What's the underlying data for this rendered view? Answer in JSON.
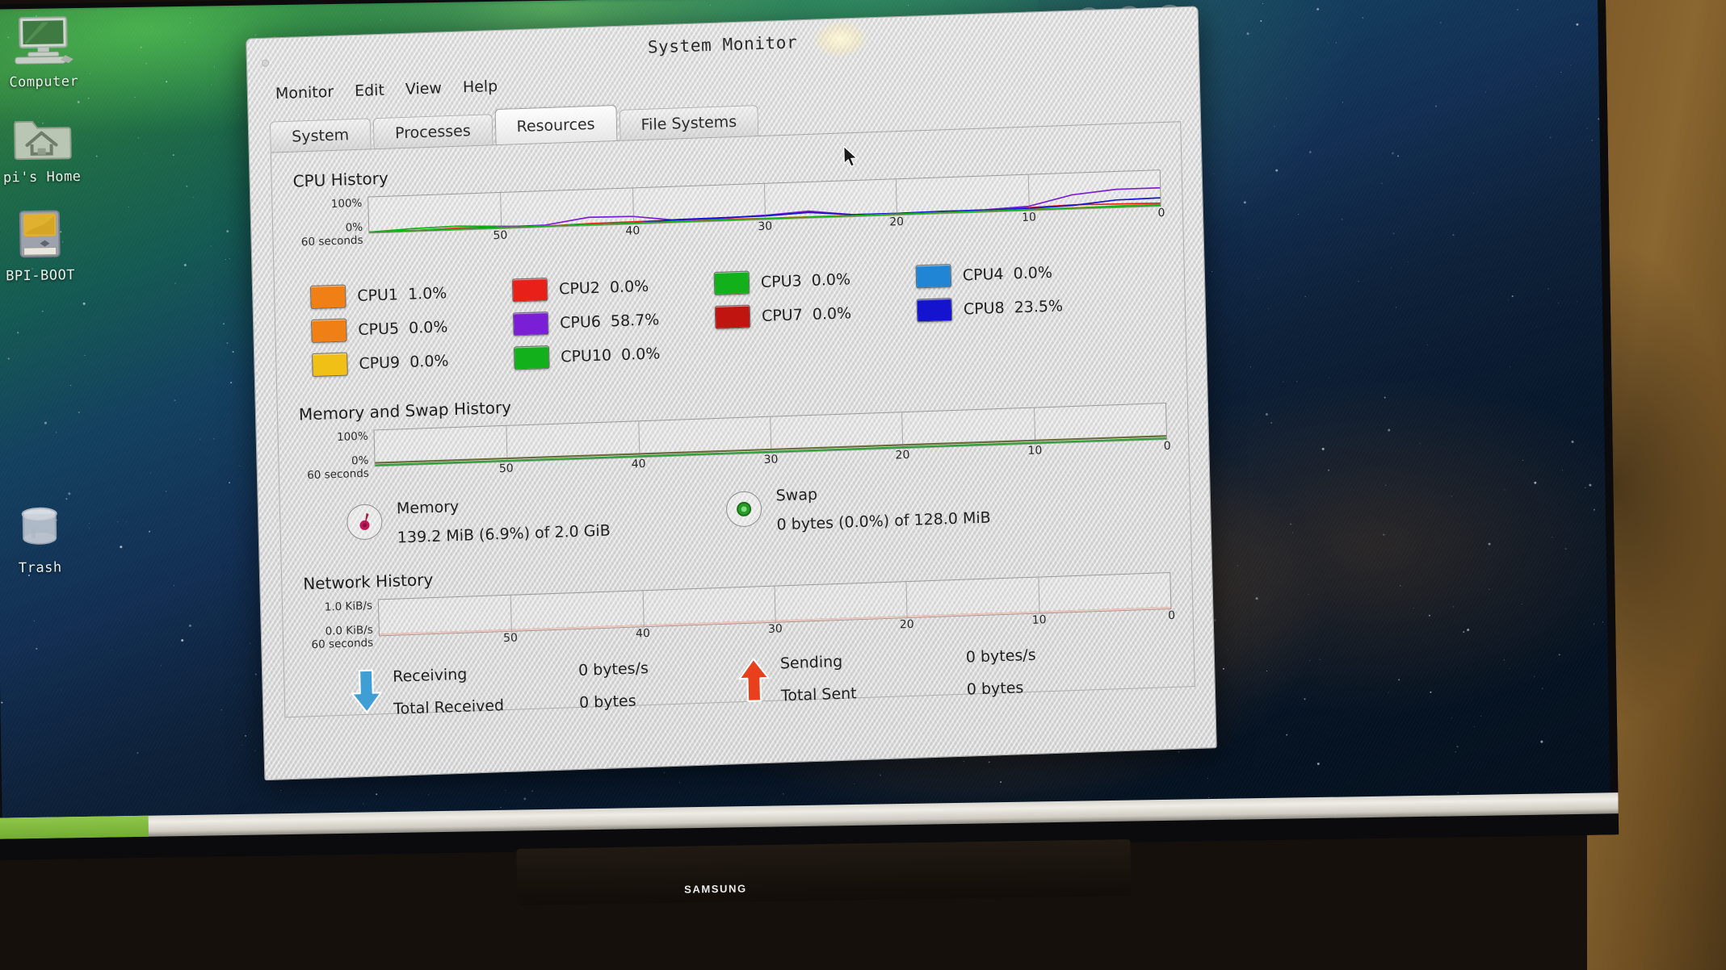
{
  "desktop": {
    "icons": [
      {
        "name": "Computer",
        "icon": "computer-icon"
      },
      {
        "name": "pi's Home",
        "icon": "home-folder-icon"
      },
      {
        "name": "BPI-BOOT",
        "icon": "drive-icon"
      },
      {
        "name": "Trash",
        "icon": "trash-icon"
      }
    ]
  },
  "tv": {
    "brand": "SAMSUNG"
  },
  "window": {
    "title": "System Monitor",
    "controls": {
      "minimize": "⌄",
      "maximize": "⌃",
      "close": "✕"
    },
    "menu": [
      "Monitor",
      "Edit",
      "View",
      "Help"
    ],
    "tabs": [
      {
        "label": "System",
        "active": false
      },
      {
        "label": "Processes",
        "active": false
      },
      {
        "label": "Resources",
        "active": true
      },
      {
        "label": "File Systems",
        "active": false
      }
    ]
  },
  "sections": {
    "cpu": {
      "title": "CPU History"
    },
    "memory": {
      "title": "Memory and Swap History"
    },
    "network": {
      "title": "Network History"
    }
  },
  "cpu_legend": [
    {
      "label": "CPU1",
      "value": "1.0%",
      "color": "#f07f16"
    },
    {
      "label": "CPU2",
      "value": "0.0%",
      "color": "#e8201a"
    },
    {
      "label": "CPU3",
      "value": "0.0%",
      "color": "#12b01a"
    },
    {
      "label": "CPU4",
      "value": "0.0%",
      "color": "#1f85d4"
    },
    {
      "label": "CPU5",
      "value": "0.0%",
      "color": "#f07f16"
    },
    {
      "label": "CPU6",
      "value": "58.7%",
      "color": "#7b1fd6"
    },
    {
      "label": "CPU7",
      "value": "0.0%",
      "color": "#bf1410"
    },
    {
      "label": "CPU8",
      "value": "23.5%",
      "color": "#1414cf"
    },
    {
      "label": "CPU9",
      "value": "0.0%",
      "color": "#f0c017"
    },
    {
      "label": "CPU10",
      "value": "0.0%",
      "color": "#12b01a"
    }
  ],
  "memory": {
    "label": "Memory",
    "value": "139.2 MiB (6.9%) of 2.0 GiB",
    "icon": "memory-dial-icon"
  },
  "swap": {
    "label": "Swap",
    "value": "0 bytes (0.0%) of 128.0 MiB",
    "icon": "swap-dial-icon"
  },
  "network": {
    "receiving": {
      "label": "Receiving",
      "value": "0 bytes/s",
      "icon": "arrow-down-icon"
    },
    "total_received": {
      "label": "Total Received",
      "value": "0 bytes"
    },
    "sending": {
      "label": "Sending",
      "value": "0 bytes/s",
      "icon": "arrow-up-icon"
    },
    "total_sent": {
      "label": "Total Sent",
      "value": "0 bytes"
    }
  },
  "chart_data": [
    {
      "type": "line",
      "title": "CPU History",
      "xlabel": "60 seconds",
      "ylabel": "",
      "ylim": [
        0,
        100
      ],
      "ytick_labels": [
        "100%",
        "0%"
      ],
      "xtick_labels": [
        "60 seconds",
        "50",
        "40",
        "30",
        "20",
        "10",
        "0"
      ],
      "x": [
        60,
        55,
        50,
        46,
        43,
        40,
        37,
        34,
        30,
        27,
        24,
        20,
        16,
        12,
        8,
        5,
        3,
        1,
        0
      ],
      "grid": true,
      "legend": "below",
      "series": [
        {
          "name": "CPU1",
          "color": "#f07f16",
          "current": 1.0,
          "values": [
            0,
            0,
            1,
            1,
            0,
            1,
            1,
            1,
            1,
            1,
            1,
            1,
            1,
            1,
            1,
            1,
            1,
            1,
            1
          ]
        },
        {
          "name": "CPU2",
          "color": "#e8201a",
          "current": 0.0,
          "values": [
            0,
            0,
            3,
            2,
            0,
            3,
            4,
            5,
            3,
            0,
            0,
            0,
            0,
            0,
            2,
            6,
            10,
            8,
            6
          ]
        },
        {
          "name": "CPU3",
          "color": "#12b01a",
          "current": 0.0,
          "values": [
            0,
            6,
            9,
            4,
            0,
            0,
            0,
            0,
            0,
            0,
            0,
            0,
            0,
            0,
            0,
            0,
            0,
            2,
            2
          ]
        },
        {
          "name": "CPU4",
          "color": "#1f85d4",
          "current": 0.0,
          "values": [
            0,
            0,
            0,
            0,
            0,
            0,
            0,
            0,
            0,
            0,
            0,
            0,
            0,
            0,
            0,
            0,
            0,
            0,
            0
          ]
        },
        {
          "name": "CPU5",
          "color": "#f07f16",
          "current": 0.0,
          "values": [
            0,
            0,
            0,
            0,
            0,
            0,
            0,
            0,
            0,
            0,
            0,
            0,
            0,
            0,
            0,
            0,
            0,
            0,
            0
          ]
        },
        {
          "name": "CPU6",
          "color": "#7b1fd6",
          "current": 58.7,
          "values": [
            0,
            0,
            0,
            2,
            3,
            22,
            20,
            4,
            6,
            10,
            18,
            3,
            2,
            3,
            4,
            10,
            40,
            52,
            52
          ]
        },
        {
          "name": "CPU7",
          "color": "#bf1410",
          "current": 0.0,
          "values": [
            0,
            0,
            0,
            0,
            0,
            0,
            0,
            0,
            0,
            0,
            0,
            0,
            0,
            0,
            0,
            0,
            0,
            0,
            0
          ]
        },
        {
          "name": "CPU8",
          "color": "#1414cf",
          "current": 23.5,
          "values": [
            0,
            0,
            0,
            0,
            0,
            0,
            0,
            6,
            7,
            8,
            14,
            3,
            2,
            4,
            3,
            4,
            8,
            20,
            22
          ]
        },
        {
          "name": "CPU9",
          "color": "#f0c017",
          "current": 0.0,
          "values": [
            0,
            0,
            0,
            0,
            0,
            0,
            0,
            0,
            0,
            0,
            0,
            0,
            0,
            0,
            0,
            0,
            0,
            0,
            0
          ]
        },
        {
          "name": "CPU10",
          "color": "#12b01a",
          "current": 0.0,
          "values": [
            0,
            0,
            0,
            0,
            0,
            0,
            0,
            0,
            0,
            0,
            0,
            0,
            0,
            0,
            0,
            0,
            0,
            0,
            0
          ]
        }
      ]
    },
    {
      "type": "line",
      "title": "Memory and Swap History",
      "xlabel": "60 seconds",
      "ylim": [
        0,
        100
      ],
      "ytick_labels": [
        "100%",
        "0%"
      ],
      "xtick_labels": [
        "60 seconds",
        "50",
        "40",
        "30",
        "20",
        "10",
        "0"
      ],
      "grid": true,
      "series": [
        {
          "name": "Memory",
          "color": "#6b6b3a",
          "current": 6.9,
          "values": [
            7,
            7,
            7,
            7,
            7,
            7,
            7,
            7,
            7,
            7,
            7,
            7,
            7
          ]
        },
        {
          "name": "Swap",
          "color": "#2fa03a",
          "current": 0.0,
          "values": [
            0,
            0,
            0,
            0,
            0,
            0,
            0,
            0,
            0,
            0,
            0,
            0,
            0
          ]
        }
      ]
    },
    {
      "type": "line",
      "title": "Network History",
      "xlabel": "60 seconds",
      "ylim": [
        0,
        1
      ],
      "ytick_labels": [
        "1.0 KiB/s",
        "0.0 KiB/s"
      ],
      "xtick_labels": [
        "60 seconds",
        "50",
        "40",
        "30",
        "20",
        "10",
        "0"
      ],
      "grid": true,
      "series": [
        {
          "name": "Receiving",
          "color": "#c0392b",
          "current": 0.0,
          "values": [
            0,
            0,
            0,
            0,
            0,
            0,
            0,
            0,
            0,
            0,
            0,
            0,
            0
          ]
        },
        {
          "name": "Sending",
          "color": "#e8c9c0",
          "current": 0.0,
          "values": [
            0,
            0,
            0,
            0,
            0,
            0,
            0,
            0,
            0,
            0,
            0,
            0,
            0
          ]
        }
      ]
    }
  ]
}
